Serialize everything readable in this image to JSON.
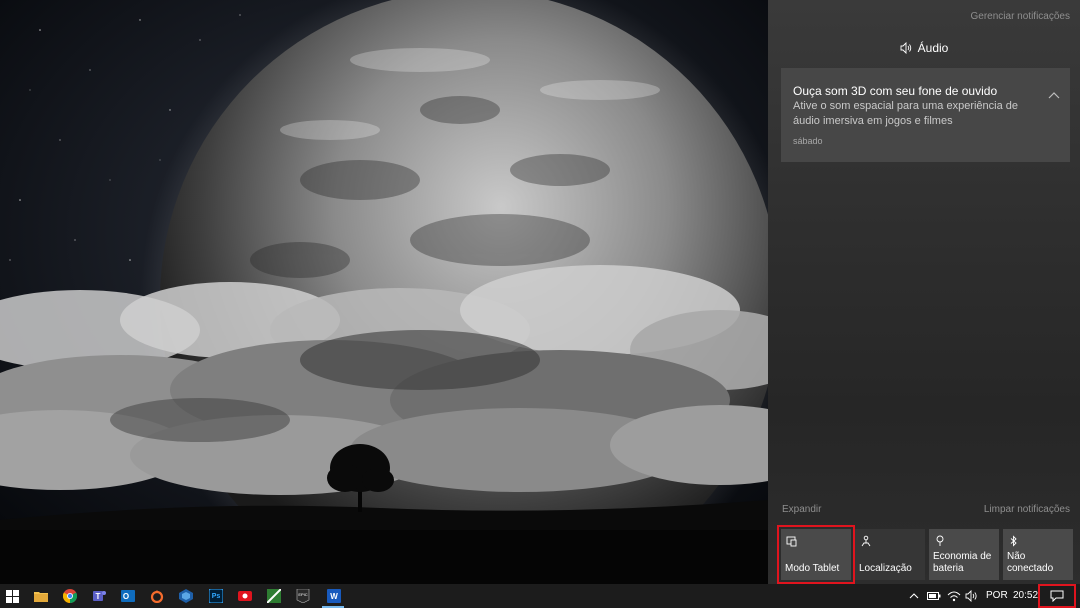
{
  "action_center": {
    "manage_notifications": "Gerenciar notificações",
    "group_title": "Áudio",
    "group_icon": "speaker-icon",
    "notification": {
      "title": "Ouça som 3D com seu fone de ouvido",
      "body": "Ative o som espacial para uma experiência de áudio imersiva em jogos e filmes",
      "time": "sábado"
    },
    "expand_label": "Expandir",
    "clear_label": "Limpar notificações",
    "quick_actions": [
      {
        "label": "Modo Tablet",
        "icon": "tablet-mode-icon",
        "active": true
      },
      {
        "label": "Localização",
        "icon": "location-icon",
        "active": false
      },
      {
        "label": "Economia de bateria",
        "icon": "battery-saver-icon",
        "active": true
      },
      {
        "label": "Não conectado",
        "icon": "bluetooth-icon",
        "active": true
      }
    ]
  },
  "taskbar": {
    "apps": [
      {
        "name": "start",
        "icon": "windows-logo-icon"
      },
      {
        "name": "file-explorer",
        "icon": "folder-icon"
      },
      {
        "name": "chrome",
        "icon": "chrome-icon"
      },
      {
        "name": "teams",
        "icon": "teams-icon"
      },
      {
        "name": "outlook",
        "icon": "outlook-icon"
      },
      {
        "name": "origin",
        "icon": "origin-icon"
      },
      {
        "name": "virtualbox",
        "icon": "virtualbox-icon"
      },
      {
        "name": "photoshop",
        "icon": "photoshop-icon",
        "text": "Ps"
      },
      {
        "name": "recorder",
        "icon": "recorder-icon"
      },
      {
        "name": "maps",
        "icon": "maps-icon"
      },
      {
        "name": "epic-games",
        "icon": "epic-games-icon",
        "text": "EPIC"
      },
      {
        "name": "word",
        "icon": "word-icon",
        "text": "W"
      }
    ],
    "tray": {
      "language": "POR",
      "time": "20:52"
    }
  },
  "colors": {
    "highlight": "#e0141e",
    "tile_active": "#4a4a4a",
    "tile_inactive": "#363636"
  }
}
